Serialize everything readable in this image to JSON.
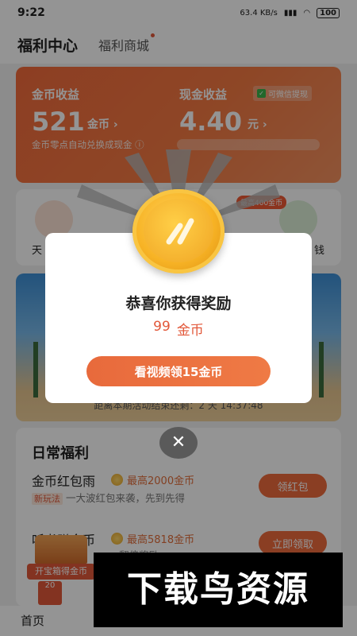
{
  "status_bar": {
    "time": "9:22",
    "net_speed": "63.4 KB/s",
    "battery": "100"
  },
  "header": {
    "active_tab": "福利中心",
    "tab_mall": "福利商城"
  },
  "earnings": {
    "coin_label": "金币收益",
    "coin_value": "521",
    "coin_unit": "金币 ›",
    "cash_label": "现金收益",
    "wechat_badge": "可微信提现",
    "cash_value": "4.40",
    "cash_unit": "元 ›",
    "note": "金币零点自动兑换成现金 ⓘ"
  },
  "icon_row": {
    "left_label": "天",
    "right_label": "钱",
    "badge": "最高400金币"
  },
  "banner": {
    "countdown": "距离本期活动结束还剩：2 天 14:37:48"
  },
  "daily": {
    "title": "日常福利",
    "rows": [
      {
        "title": "金币红包雨",
        "max": "最高2000金币",
        "tag": "新玩法",
        "sub": "一大波红包来袭，先到先得",
        "button": "领红包"
      },
      {
        "title": "听书赚金币",
        "max": "最高5818金币",
        "sub": "翻倍奖励",
        "button": "立即领取"
      }
    ]
  },
  "treasure": {
    "label": "开宝箱得金币",
    "card1": "20",
    "card2": ""
  },
  "bottom_nav": {
    "home": "首页"
  },
  "dialog": {
    "title": "恭喜你获得奖励",
    "amount": "99",
    "amount_unit": "金币",
    "button": "看视频领15金币",
    "close": "✕"
  },
  "watermark": "下载鸟资源",
  "colors": {
    "accent": "#ee6b3d",
    "earn_card": "#f47a43",
    "coin": "#f7b325"
  }
}
